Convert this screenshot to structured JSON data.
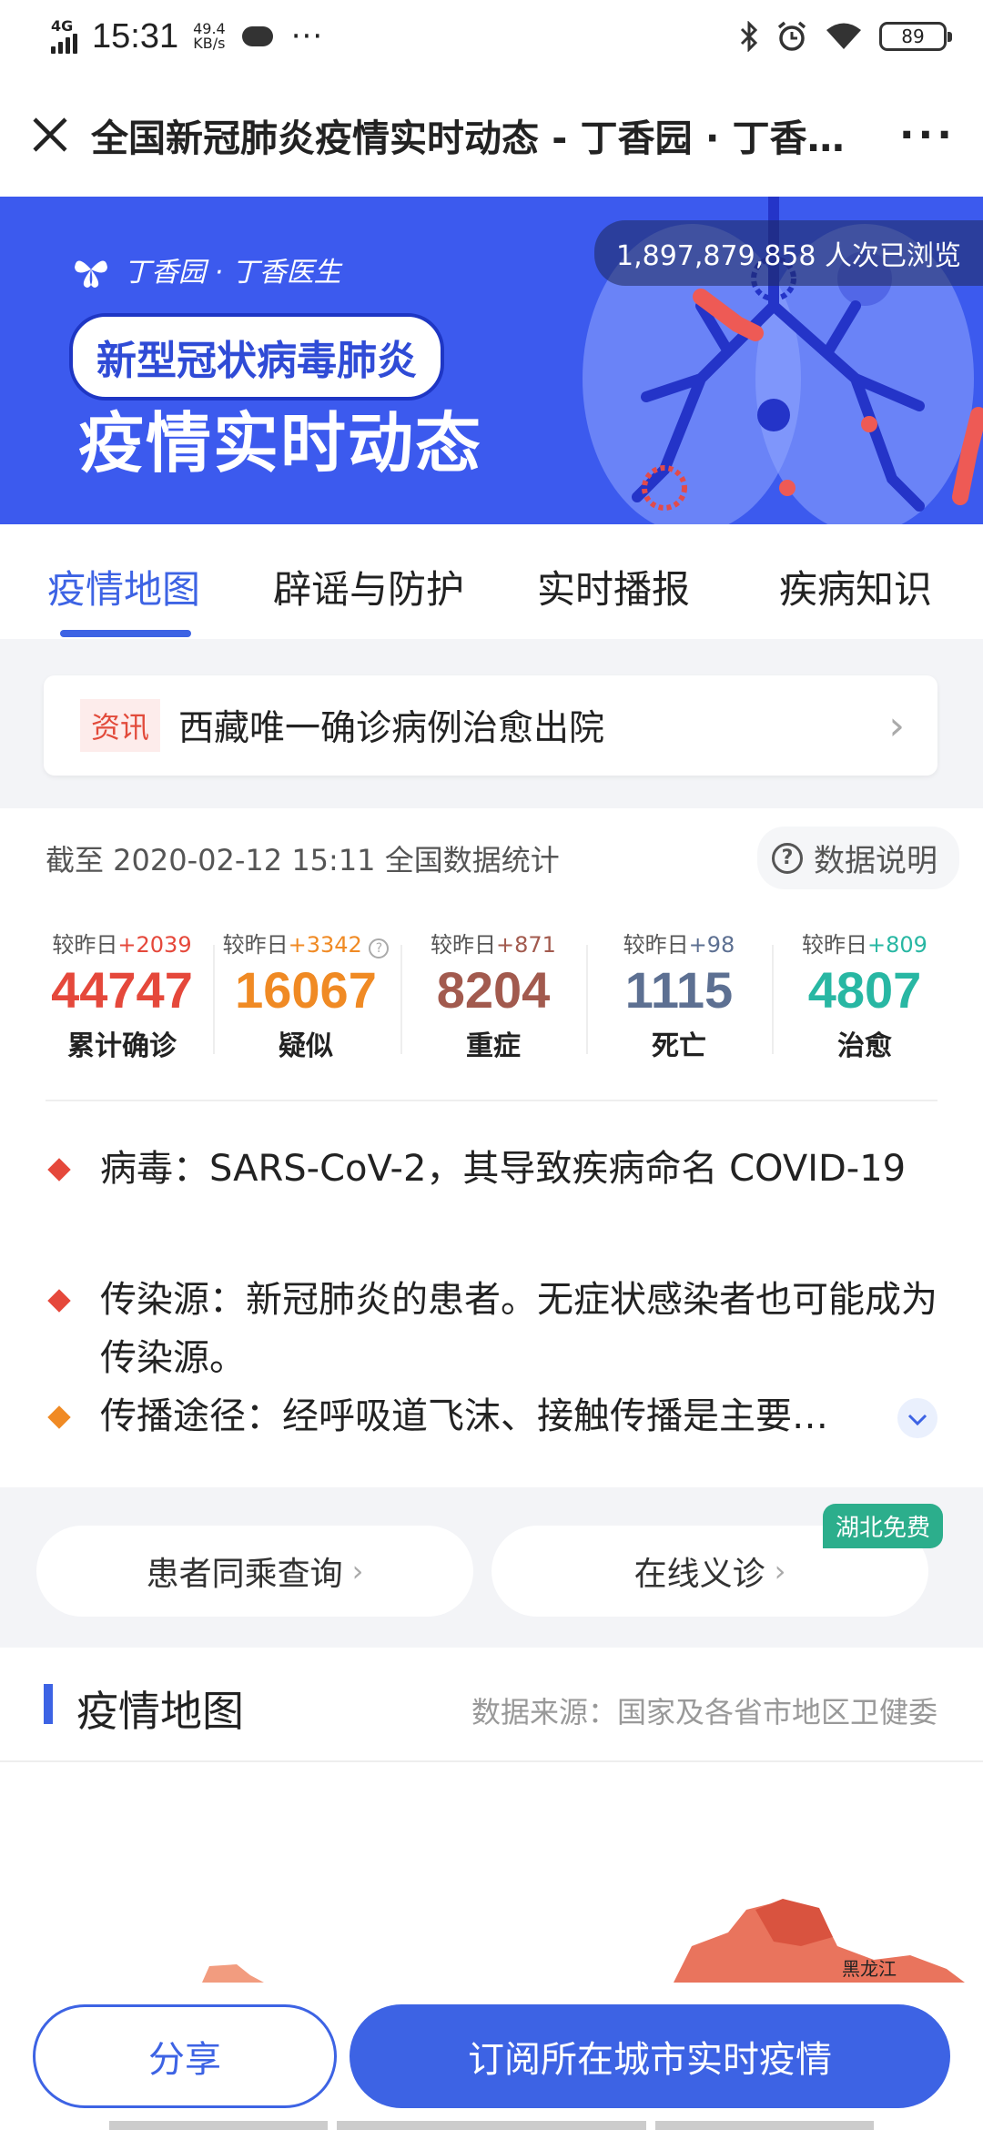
{
  "status_bar": {
    "network": "4G",
    "time": "15:31",
    "speed_value": "49.4",
    "speed_unit": "KB/s",
    "battery": "89"
  },
  "titlebar": {
    "title": "全国新冠肺炎疫情实时动态 - 丁香园 · 丁香医生"
  },
  "banner": {
    "brand": "丁香园 · 丁香医生",
    "pill": "新型冠状病毒肺炎",
    "headline": "疫情实时动态",
    "views": "1,897,879,858 人次已浏览"
  },
  "tabs": [
    {
      "label": "疫情地图"
    },
    {
      "label": "辟谣与防护"
    },
    {
      "label": "实时播报"
    },
    {
      "label": "疾病知识"
    }
  ],
  "news": {
    "tag": "资讯",
    "text": "西藏唯一确诊病例治愈出院"
  },
  "stats": {
    "as_of": "截至 2020-02-12 15:11 全国数据统计",
    "explain": "数据说明",
    "items": [
      {
        "delta_prefix": "较昨日",
        "delta": "+2039",
        "value": "44747",
        "label": "累计确诊",
        "color": "#e5483b"
      },
      {
        "delta_prefix": "较昨日",
        "delta": "+3342",
        "value": "16067",
        "label": "疑似",
        "color": "#f08a24"
      },
      {
        "delta_prefix": "较昨日",
        "delta": "+871",
        "value": "8204",
        "label": "重症",
        "color": "#a25a4e"
      },
      {
        "delta_prefix": "较昨日",
        "delta": "+98",
        "value": "1115",
        "label": "死亡",
        "color": "#5d7092"
      },
      {
        "delta_prefix": "较昨日",
        "delta": "+809",
        "value": "4807",
        "label": "治愈",
        "color": "#28b7a3"
      }
    ]
  },
  "facts": [
    {
      "text": "病毒：SARS-CoV-2，其导致疾病命名 COVID-19",
      "color": "#e5483b"
    },
    {
      "text": "传染源：新冠肺炎的患者。无症状感染者也可能成为传染源。",
      "color": "#e5483b"
    },
    {
      "text": "传播途径：经呼吸道飞沫、接触传播是主要…",
      "color": "#f08a24"
    }
  ],
  "quick": {
    "left": "患者同乘查询",
    "right": "在线义诊",
    "badge": "湖北免费"
  },
  "map": {
    "title": "疫情地图",
    "source": "数据来源：国家及各省市地区卫健委",
    "region_label": "黑龙江"
  },
  "bottom": {
    "share": "分享",
    "subscribe": "订阅所在城市实时疫情"
  },
  "colors": {
    "accent": "#3d63e4",
    "banner": "#3c5aee"
  }
}
